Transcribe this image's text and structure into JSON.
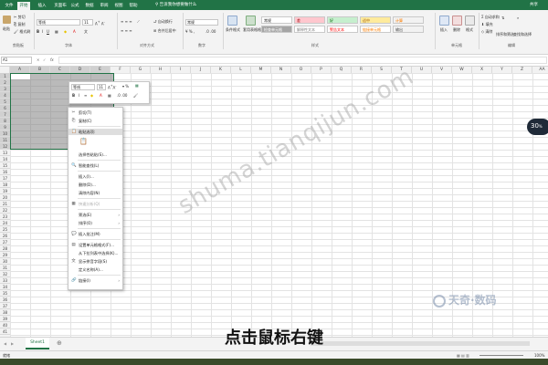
{
  "ribbon": {
    "tabs": [
      "文件",
      "开始",
      "插入",
      "页面布局",
      "公式",
      "数据",
      "审阅",
      "视图",
      "帮助"
    ],
    "active_tab": "开始",
    "tell_me": "告诉我你想要做什么",
    "share": "共享",
    "clipboard": {
      "paste": "粘贴",
      "cut": "剪切",
      "copy": "复制",
      "format_painter": "格式刷",
      "label": "剪贴板"
    },
    "font": {
      "name": "等线",
      "size": "11",
      "label": "字体"
    },
    "alignment": {
      "wrap": "自动换行",
      "merge": "合并后居中",
      "label": "对齐方式"
    },
    "number": {
      "format": "常规",
      "label": "数字"
    },
    "styles": {
      "conditional": "条件格式",
      "table": "套用表格格式",
      "cells": [
        {
          "text": "常规",
          "bg": "#ffffff",
          "fg": "#222222"
        },
        {
          "text": "差",
          "bg": "#ffc7ce",
          "fg": "#9c0006"
        },
        {
          "text": "好",
          "bg": "#c6efce",
          "fg": "#006100"
        },
        {
          "text": "适中",
          "bg": "#ffeb9c",
          "fg": "#9c5700"
        },
        {
          "text": "计算",
          "bg": "#f2f2f2",
          "fg": "#fa7d00"
        },
        {
          "text": "检查单元格",
          "bg": "#a5a5a5",
          "fg": "#ffffff"
        },
        {
          "text": "解释性文本",
          "bg": "#ffffff",
          "fg": "#7f7f7f"
        },
        {
          "text": "警告文本",
          "bg": "#ffffff",
          "fg": "#ff0000"
        },
        {
          "text": "链接单元格",
          "bg": "#ffffff",
          "fg": "#fa7d00"
        },
        {
          "text": "输出",
          "bg": "#f2f2f2",
          "fg": "#3f3f3f"
        }
      ],
      "label": "样式"
    },
    "cells_group": {
      "insert": "插入",
      "delete": "删除",
      "format": "格式",
      "label": "单元格"
    },
    "editing": {
      "autosum": "自动求和",
      "fill": "填充",
      "clear": "清除",
      "sort": "排序和筛选",
      "find": "查找和选择",
      "label": "编辑"
    }
  },
  "formula_bar": {
    "name_box": "A1",
    "fx": "fx",
    "value": ""
  },
  "grid": {
    "columns": [
      "A",
      "B",
      "C",
      "D",
      "E",
      "F",
      "G",
      "H",
      "I",
      "J",
      "K",
      "L",
      "M",
      "N",
      "O",
      "P",
      "Q",
      "R",
      "S",
      "T",
      "U",
      "V",
      "W",
      "X",
      "Y",
      "Z",
      "AA"
    ],
    "rows": [
      "1",
      "2",
      "3",
      "4",
      "5",
      "6",
      "7",
      "8",
      "9",
      "10",
      "11",
      "12",
      "13",
      "14",
      "15",
      "16",
      "17",
      "18",
      "19",
      "20",
      "21",
      "22",
      "23",
      "24",
      "25",
      "26",
      "27",
      "28",
      "29",
      "30",
      "31",
      "32",
      "33",
      "34",
      "35",
      "36",
      "37",
      "38",
      "39",
      "40",
      "41"
    ]
  },
  "mini_toolbar": {
    "font": "等线",
    "size": "11",
    "bold": "B",
    "italic": "I"
  },
  "context_menu": [
    {
      "label": "剪切(T)",
      "icon": "✂",
      "state": "normal"
    },
    {
      "label": "复制(C)",
      "icon": "⎘",
      "state": "normal"
    },
    {
      "label": "粘贴选项:",
      "icon": "📋",
      "state": "highlight"
    },
    {
      "label": "",
      "icon": "📋",
      "state": "paste-icon"
    },
    {
      "label": "选择性粘贴(S)...",
      "icon": "",
      "state": "normal"
    },
    {
      "label": "智能查找(L)",
      "icon": "🔍",
      "state": "normal"
    },
    {
      "label": "插入(I)...",
      "icon": "",
      "state": "normal"
    },
    {
      "label": "删除(D)...",
      "icon": "",
      "state": "normal"
    },
    {
      "label": "清除内容(N)",
      "icon": "",
      "state": "normal"
    },
    {
      "label": "快速分析(Q)",
      "icon": "▦",
      "state": "disabled"
    },
    {
      "label": "筛选(E)",
      "icon": "",
      "state": "submenu"
    },
    {
      "label": "排序(O)",
      "icon": "",
      "state": "submenu"
    },
    {
      "label": "插入批注(M)",
      "icon": "💬",
      "state": "normal"
    },
    {
      "label": "设置单元格格式(F)...",
      "icon": "▤",
      "state": "normal"
    },
    {
      "label": "从下拉列表中选择(K)...",
      "icon": "",
      "state": "normal"
    },
    {
      "label": "显示拼音字段(S)",
      "icon": "文",
      "state": "normal"
    },
    {
      "label": "定义名称(A)...",
      "icon": "",
      "state": "normal"
    },
    {
      "label": "链接(I)",
      "icon": "🔗",
      "state": "submenu"
    }
  ],
  "sheets": [
    "Sheet1"
  ],
  "status": {
    "ready": "就绪",
    "zoom": "100%"
  },
  "speed_widget": {
    "value": "30",
    "unit": "%"
  },
  "watermark": "shuma.tianqijun.com",
  "logo_text": "天奇·数码",
  "caption": "点击鼠标右键",
  "colors": {
    "excel_green": "#217346",
    "selection": "#8c8c8c"
  }
}
